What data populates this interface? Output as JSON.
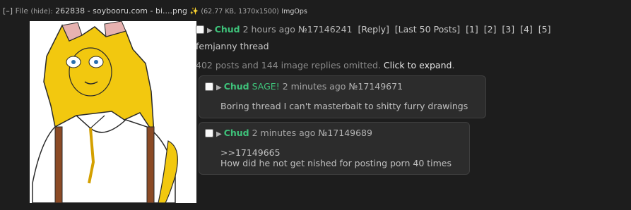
{
  "file": {
    "toggle": "[–]",
    "label": "File",
    "hide": "(hide):",
    "name": "262838 - soybooru.com - bi....png",
    "meta": "(62.77 KB, 1370x1500)",
    "imgops": "ImgOps"
  },
  "op": {
    "name": "Chud",
    "time": "2 hours ago",
    "number": "№17146241",
    "links": [
      "[Reply]",
      "[Last 50 Posts]",
      "[1]",
      "[2]",
      "[3]",
      "[4]",
      "[5]"
    ],
    "subject": "femjanny thread",
    "omitted": "402 posts and 144 image replies omitted.",
    "expand": "Click to expand",
    "period": "."
  },
  "replies": [
    {
      "name": "Chud",
      "sage": "SAGE!",
      "time": "2 minutes ago",
      "number": "№17149671",
      "body": "Boring thread I can't masterbait to shitty furry drawings"
    },
    {
      "name": "Chud",
      "time": "2 minutes ago",
      "number": "№17149689",
      "quote": ">>17149665",
      "body": "How did he not get nished for posting porn 40 times"
    }
  ],
  "colors": {
    "background": "#1d1d1d",
    "name": "#3ec27a",
    "reply_bg": "#2c2c2c"
  },
  "icons": {
    "file_search": "search-icon",
    "post_arrow": "triangle-right-icon"
  }
}
